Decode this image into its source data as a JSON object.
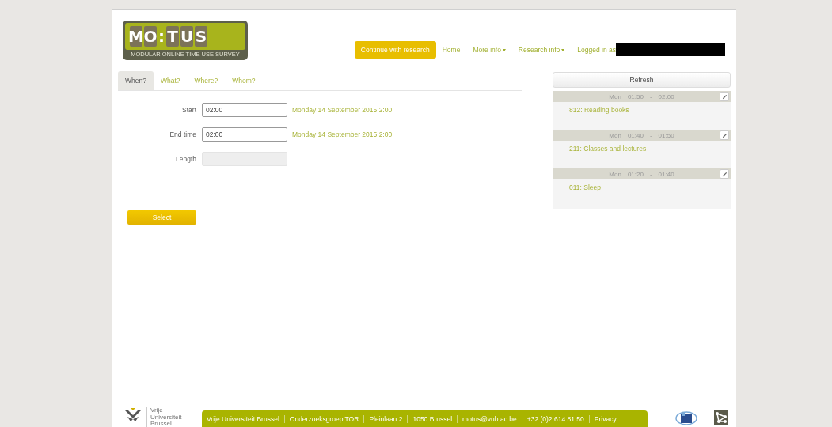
{
  "logo": {
    "letters": [
      "M",
      "O",
      ":",
      "T",
      "U",
      "S"
    ],
    "tagline": "MODULAR ONLINE TIME USE SURVEY"
  },
  "nav": {
    "primary": "Continue with research",
    "links": [
      {
        "label": "Home",
        "dropdown": false
      },
      {
        "label": "More info",
        "dropdown": true
      },
      {
        "label": "Research info",
        "dropdown": true
      }
    ],
    "logged_in": "Logged in as"
  },
  "tabs": [
    {
      "label": "When?",
      "selected": true
    },
    {
      "label": "What?",
      "selected": false
    },
    {
      "label": "Where?",
      "selected": false
    },
    {
      "label": "Whom?",
      "selected": false
    }
  ],
  "form": [
    {
      "label": "Start",
      "value": "02:00",
      "disabled": false,
      "hint": "Monday 14 September 2015 2:00"
    },
    {
      "label": "End time",
      "value": "02:00",
      "disabled": false,
      "hint": "Monday 14 September 2015 2:00"
    },
    {
      "label": "Length",
      "disabled": true
    }
  ],
  "select_button": "Select",
  "refresh_button": "Refresh",
  "entries": [
    {
      "day": "Mon",
      "start": "01:50",
      "sep": "-",
      "end": "02:00",
      "activity": "812: Reading books"
    },
    {
      "day": "Mon",
      "start": "01:40",
      "sep": "-",
      "end": "01:50",
      "activity": "211: Classes and lectures"
    },
    {
      "day": "Mon",
      "start": "01:20",
      "sep": "-",
      "end": "01:40",
      "activity": "011: Sleep"
    }
  ],
  "footer": {
    "university": [
      "Vrije",
      "Universiteit",
      "Brussel"
    ],
    "items": [
      "Vrije Universiteit Brussel",
      "Onderzoeksgroep TOR",
      "Pleinlaan 2",
      "1050 Brussel",
      "motus@vub.ac.be",
      "+32 (0)2 614 81 50",
      "Privacy"
    ]
  }
}
